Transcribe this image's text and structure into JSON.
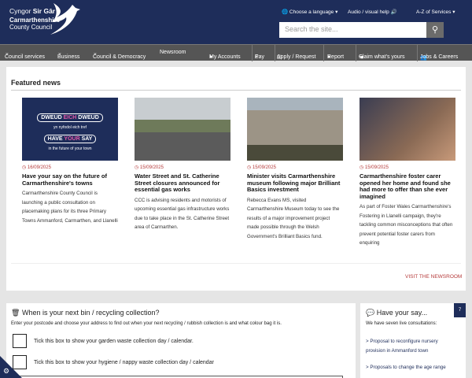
{
  "header": {
    "logo_line1_a": "Cyngor ",
    "logo_line1_b": "Sir Gâr",
    "logo_line2": "Carmarthenshire",
    "logo_line3": "County Council",
    "language": "Choose a language",
    "audio": "Audio / visual help",
    "az": "A-Z of Services",
    "search_placeholder": "Search the site..."
  },
  "nav": {
    "left": [
      "Council services",
      "Business",
      "Council & Democracy",
      "Newsroom"
    ],
    "right": [
      "My Accounts",
      "Pay",
      "Apply / Request",
      "Report",
      "Claim what's yours",
      "Jobs & Careers"
    ]
  },
  "featured": {
    "heading": "Featured news",
    "visit": "VISIT THE NEWSROOM",
    "image1": {
      "l1a": "DWEUD ",
      "l1b": "EICH",
      "l1c": " DWEUD",
      "l2": "yn nyfodol eich tref",
      "l3a": "HAVE ",
      "l3b": "YOUR",
      "l3c": " SAY",
      "l4": "in the future of your town"
    },
    "cards": [
      {
        "date": "16/09/2025",
        "title": "Have your say on the future of Carmarthenshire's towns",
        "desc": "Carmarthenshire County Council is launching a public consultation on placemaking plans for its three Primary Towns Ammanford, Carmarthen, and Llanelli"
      },
      {
        "date": "15/09/2025",
        "title": "Water Street and St. Catherine Street closures announced for essential gas works",
        "desc": "CCC is advising residents and motorists of upcoming essential gas infrastructure works due to take place in the St. Catherine Street area of Carmarthen."
      },
      {
        "date": "15/09/2025",
        "title": "Minister visits Carmarthenshire museum following major Brilliant Basics investment",
        "desc": "Rebecca Evans MS, visited Carmarthenshire Museum today to see the results of a major improvement project made possible through the Welsh Government's Brilliant Basics fund."
      },
      {
        "date": "15/09/2025",
        "title": "Carmarthenshire foster carer opened her home and found she had more to offer than she ever imagined",
        "desc": "As part of Foster Wales Carmarthenshire's Fostering in Llanelli campaign, they're tackling common misconceptions that often prevent potential foster carers from enquiring"
      }
    ]
  },
  "bin": {
    "heading": "When is your next bin / recycling collection?",
    "intro": "Enter your postcode and choose your address to find out when your next recycling / rubbish collection is and what colour bag it is.",
    "garden": "Tick this box to show your garden waste collection day / calendar.",
    "hygiene": "Tick this box to show your hygiene / nappy waste collection day / calendar"
  },
  "say": {
    "heading": "Have your say...",
    "intro": "We have seven live consultations:",
    "links": [
      "> Proposal to reconfigure nursery provision in Ammanford town",
      "> Proposals to change the age range"
    ],
    "badge": "7"
  }
}
